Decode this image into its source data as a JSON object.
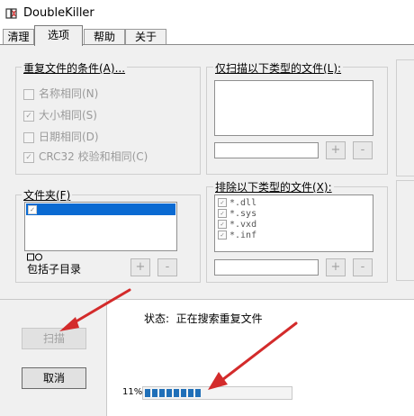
{
  "window": {
    "title": "DoubleKiller",
    "icon": "app-icon"
  },
  "tabs": [
    {
      "label": "清理"
    },
    {
      "label": "选项"
    },
    {
      "label": "帮助"
    },
    {
      "label": "关于"
    }
  ],
  "conditions": {
    "group_label": "重复文件的条件(A)...",
    "items": [
      {
        "label": "名称相同(N)",
        "checked": false
      },
      {
        "label": "大小相同(S)",
        "checked": true
      },
      {
        "label": "日期相同(D)",
        "checked": false
      },
      {
        "label": "CRC32 校验和相同(C)",
        "checked": true
      }
    ]
  },
  "include_types": {
    "group_label": "仅扫描以下类型的文件(L):",
    "add_label": "+",
    "remove_label": "-"
  },
  "folders": {
    "group_label": "文件夹(F)",
    "subdirs_label": "包括子目录",
    "add_label": "+",
    "remove_label": "-"
  },
  "exclude_types": {
    "group_label": "排除以下类型的文件(X):",
    "items": [
      {
        "label": "*.dll",
        "checked": true
      },
      {
        "label": "*.sys",
        "checked": true
      },
      {
        "label": "*.vxd",
        "checked": true
      },
      {
        "label": "*.inf",
        "checked": true
      }
    ],
    "add_label": "+",
    "remove_label": "-"
  },
  "actions": {
    "scan_label": "扫描",
    "cancel_label": "取消"
  },
  "status": {
    "text": "状态:  正在搜索重复文件",
    "progress_label": "11%",
    "progress_fraction": 0.11
  },
  "colors": {
    "progress": "#1f6fb8",
    "annotation_arrow": "#d32b2b"
  }
}
